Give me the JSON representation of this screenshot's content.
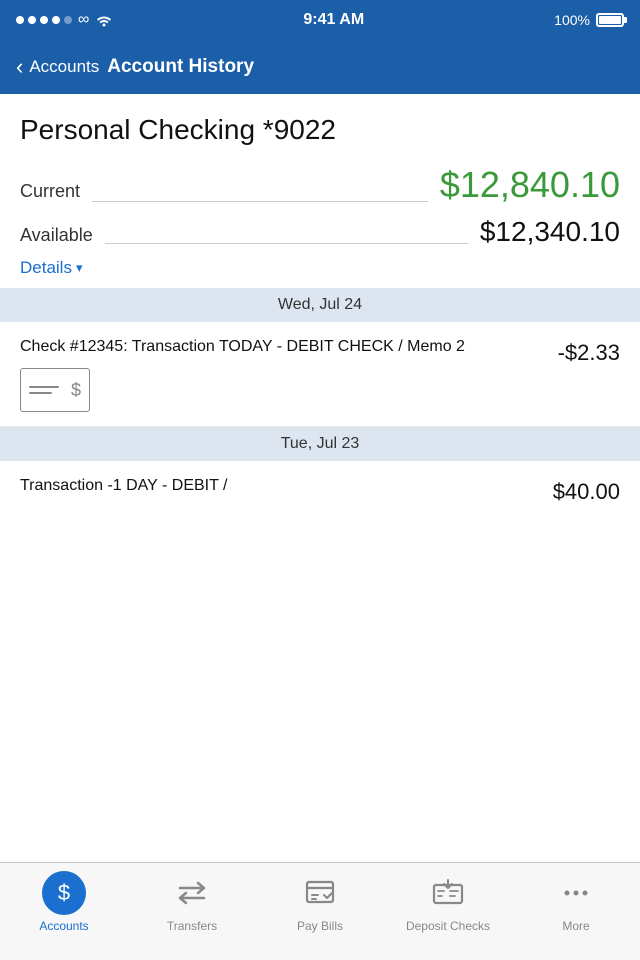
{
  "statusBar": {
    "time": "9:41 AM",
    "battery": "100%",
    "signal_dots": 4
  },
  "navBar": {
    "back_label": "Accounts",
    "title": "Account History"
  },
  "account": {
    "name": "Personal Checking *9022",
    "current_label": "Current",
    "current_balance": "$12,840.10",
    "available_label": "Available",
    "available_balance": "$12,340.10",
    "details_label": "Details"
  },
  "sections": [
    {
      "date": "Wed, Jul 24",
      "transactions": [
        {
          "description": "Check #12345: Transaction TODAY - DEBIT CHECK / Memo 2",
          "amount": "-$2.33",
          "has_check_icon": true
        }
      ]
    },
    {
      "date": "Tue, Jul 23",
      "transactions": [
        {
          "description": "Transaction -1 DAY - DEBIT /",
          "amount": "$40.00",
          "has_check_icon": false
        }
      ]
    }
  ],
  "tabBar": {
    "items": [
      {
        "id": "accounts",
        "label": "Accounts",
        "active": true
      },
      {
        "id": "transfers",
        "label": "Transfers",
        "active": false
      },
      {
        "id": "pay-bills",
        "label": "Pay Bills",
        "active": false
      },
      {
        "id": "deposit-checks",
        "label": "Deposit Checks",
        "active": false
      },
      {
        "id": "more",
        "label": "More",
        "active": false
      }
    ]
  }
}
